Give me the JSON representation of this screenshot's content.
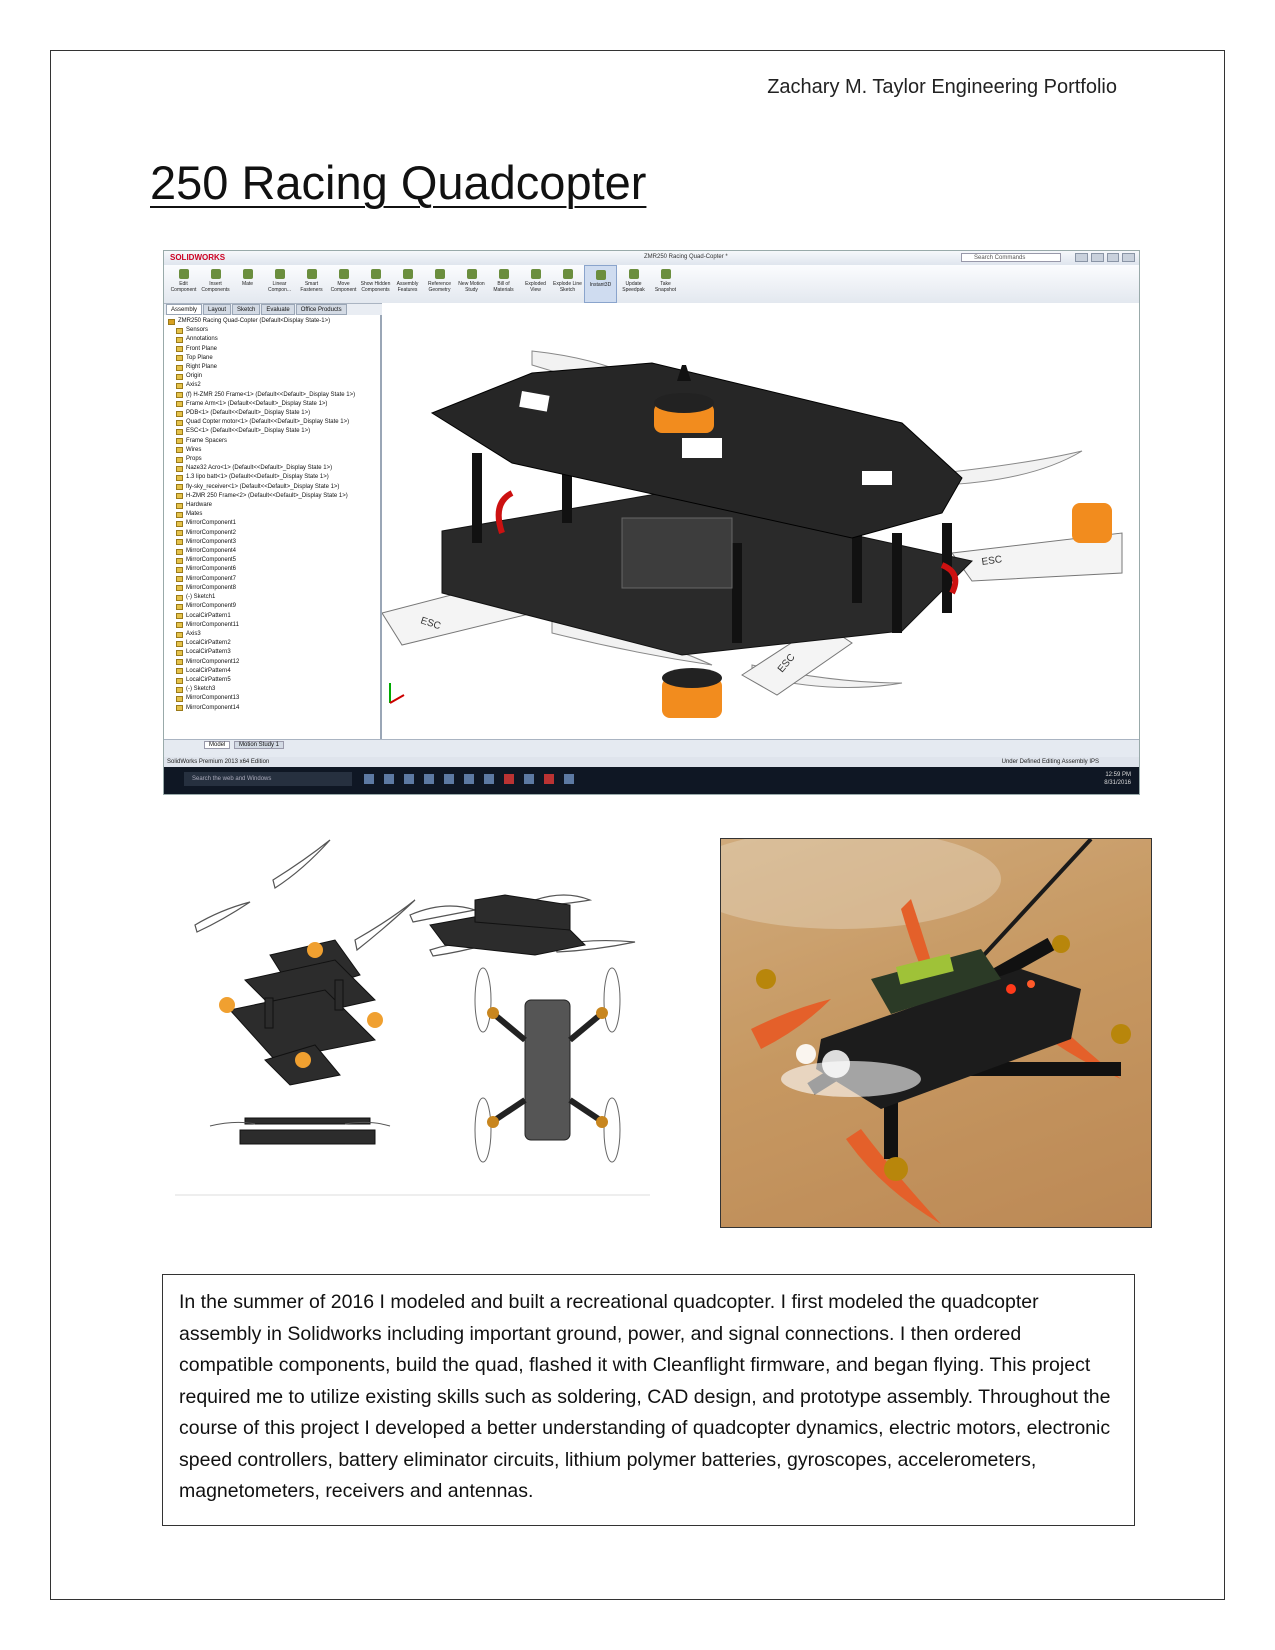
{
  "header": {
    "portfolio_owner": "Zachary M. Taylor Engineering Portfolio"
  },
  "title": "250 Racing Quadcopter",
  "solidworks": {
    "logo": "SOLIDWORKS",
    "document_title": "ZMR250 Racing Quad-Copter *",
    "search_placeholder": "Search Commands",
    "ribbon": [
      "Edit Component",
      "Insert Components",
      "Mate",
      "Linear Compon...",
      "Smart Fasteners",
      "Move Component",
      "Show Hidden Components",
      "Assembly Features",
      "Reference Geometry",
      "New Motion Study",
      "Bill of Materials",
      "Exploded View",
      "Explode Line Sketch",
      "Instant3D",
      "Update Speedpak",
      "Take Snapshot"
    ],
    "tabs": [
      "Assembly",
      "Layout",
      "Sketch",
      "Evaluate",
      "Office Products"
    ],
    "tree": [
      "ZMR250 Racing Quad-Copter (Default<Display State-1>)",
      "Sensors",
      "Annotations",
      "Front Plane",
      "Top Plane",
      "Right Plane",
      "Origin",
      "Axis2",
      "(f) H-ZMR 250 Frame<1> (Default<<Default>_Display State 1>)",
      "Frame Arm<1> (Default<<Default>_Display State 1>)",
      "PDB<1> (Default<<Default>_Display State 1>)",
      "Quad Copter motor<1> (Default<<Default>_Display State 1>)",
      "ESC<1> (Default<<Default>_Display State 1>)",
      "Frame Spacers",
      "Wires",
      "Props",
      "Naze32 Acro<1> (Default<<Default>_Display State 1>)",
      "1.3 lipo batt<1> (Default<<Default>_Display State 1>)",
      "fly-sky_receiver<1> (Default<<Default>_Display State 1>)",
      "H-ZMR 250 Frame<2> (Default<<Default>_Display State 1>)",
      "Hardware",
      "Mates",
      "MirrorComponent1",
      "MirrorComponent2",
      "MirrorComponent3",
      "MirrorComponent4",
      "MirrorComponent5",
      "MirrorComponent6",
      "MirrorComponent7",
      "MirrorComponent8",
      "(-) Sketch1",
      "MirrorComponent9",
      "LocalCirPattern1",
      "MirrorComponent11",
      "Axis3",
      "LocalCirPattern2",
      "LocalCirPattern3",
      "MirrorComponent12",
      "LocalCirPattern4",
      "LocalCirPattern5",
      "(-) Sketch3",
      "MirrorComponent13",
      "MirrorComponent14"
    ],
    "bottom_tabs": [
      "Model",
      "Motion Study 1"
    ],
    "status_left": "SolidWorks Premium 2013 x64 Edition",
    "status_right": "Under Defined     Editing Assembly          IPS",
    "taskbar_search": "Search the web and Windows",
    "clock_time": "12:59 PM",
    "clock_date": "8/31/2016"
  },
  "esc_label": "ESC",
  "description": "In the summer of 2016 I modeled and built a recreational quadcopter.  I first modeled the quadcopter assembly in Solidworks including important ground, power, and signal connections.  I then ordered compatible components, build the quad, flashed it with Cleanflight firmware, and began flying.  This project required me to utilize existing skills such as soldering, CAD design, and prototype assembly.  Throughout the course of this project I developed a better understanding of quadcopter dynamics, electric motors, electronic speed controllers, battery eliminator circuits, lithium polymer batteries, gyroscopes, accelerometers, magnetometers, receivers and antennas."
}
